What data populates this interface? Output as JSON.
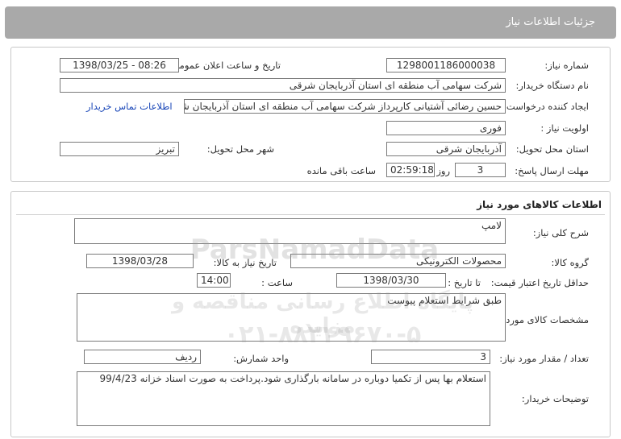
{
  "header": {
    "title": "جزئیات اطلاعات نیاز"
  },
  "need": {
    "need_number_label": "شماره نیاز:",
    "need_number": "1298001186000038",
    "announce_label": "تاریخ و ساعت اعلان عمومی:",
    "announce_value": "1398/03/25 - 08:26",
    "buyer_label": "نام دستگاه خریدار:",
    "buyer_value": "شرکت سهامی آب منطقه ای استان آذربایجان شرقی",
    "requester_label": "ایجاد کننده درخواست:",
    "requester_value": "حسین رضائی آشتیانی کارپرداز شرکت سهامی آب منطقه ای استان آذربایجان شرقی",
    "contact_link": "اطلاعات تماس خریدار",
    "priority_label": "اولویت نیاز :",
    "priority_value": "فوری",
    "province_label": "استان محل تحویل:",
    "province_value": "آذربایجان شرقی",
    "city_label": "شهر محل تحویل:",
    "city_value": "تبریز",
    "deadline_label": "مهلت ارسال پاسخ:",
    "days_value": "3",
    "days_label": "روز و",
    "time_value": "02:59:18",
    "remaining_label": "ساعت باقی مانده"
  },
  "goods": {
    "section_title": "اطلاعات کالاهای مورد نیاز",
    "desc_label": "شرح کلی نیاز:",
    "desc_value": "لامپ",
    "group_label": "گروه کالا:",
    "group_value": "محصولات الکترونیکی",
    "need_date_label": "تاریخ نیاز به کالا:",
    "need_date_value": "1398/03/28",
    "price_valid_label": "حداقل تاریخ اعتبار قیمت:",
    "to_date_label": "تا تاریخ :",
    "to_date_value": "1398/03/30",
    "hour_label": "ساعت :",
    "hour_value": "14:00",
    "spec_label": "مشخصات کالای مورد نیاز:",
    "spec_value": "طبق شرایط استعلام پیوست",
    "qty_label": "تعداد / مقدار مورد نیاز:",
    "qty_value": "3",
    "unit_label": "واحد شمارش:",
    "unit_value": "ردیف",
    "notes_label": "توضیحات خریدار:",
    "notes_value": "استعلام بها پس از تکمیا دوباره در سامانه بارگذاری شود.پرداخت به صورت اسناد خزانه  99/4/23"
  },
  "watermark": {
    "brand": "ParsNamadData",
    "line1": "پایگاه اطلاع رسانی مناقصه و مزایده",
    "line2": "۰۲۱-۸۸۳۴۹۶۷۰-۵"
  }
}
